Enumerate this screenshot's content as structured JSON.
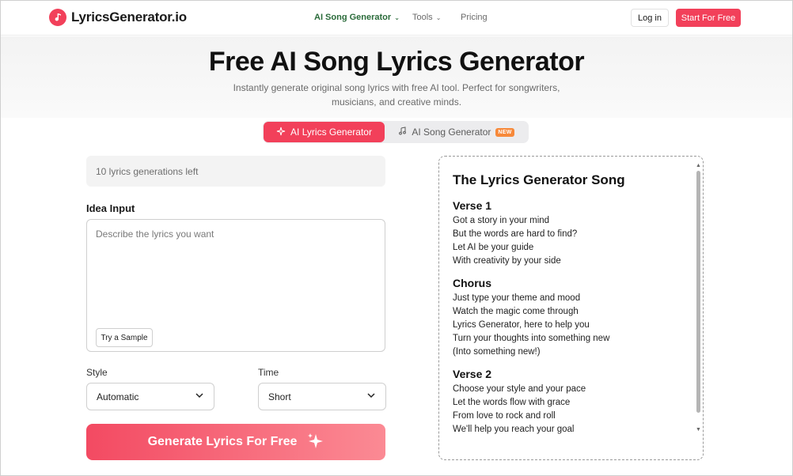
{
  "header": {
    "logo_text": "LyricsGenerator.io",
    "nav": [
      {
        "label": "AI Song Generator",
        "active": true
      },
      {
        "label": "Tools",
        "active": false
      },
      {
        "label": "Pricing",
        "active": false
      }
    ],
    "login_label": "Log in",
    "start_label": "Start For Free"
  },
  "hero": {
    "title": "Free AI Song Lyrics Generator",
    "subtitle": "Instantly generate original song lyrics with free AI tool. Perfect for songwriters, musicians, and creative minds."
  },
  "tabs": [
    {
      "label": "AI Lyrics Generator",
      "active": true
    },
    {
      "label": "AI Song Generator",
      "active": false,
      "badge": "NEW"
    }
  ],
  "form": {
    "generations_left": "10 lyrics generations left",
    "idea_label": "Idea Input",
    "idea_placeholder": "Describe the lyrics you want",
    "sample_label": "Try a Sample",
    "style_label": "Style",
    "style_value": "Automatic",
    "time_label": "Time",
    "time_value": "Short",
    "generate_label": "Generate Lyrics For Free"
  },
  "lyrics": {
    "title": "The Lyrics Generator Song",
    "sections": [
      {
        "heading": "Verse 1",
        "lines": [
          "Got a story in your mind",
          "But the words are hard to find?",
          "Let AI be your guide",
          "With creativity by your side"
        ]
      },
      {
        "heading": "Chorus",
        "lines": [
          "Just type your theme and mood",
          "Watch the magic come through",
          "Lyrics Generator, here to help you",
          "Turn your thoughts into something new",
          "(Into something new!)"
        ]
      },
      {
        "heading": "Verse 2",
        "lines": [
          "Choose your style and your pace",
          "Let the words flow with grace",
          "From love to rock and roll",
          "We'll help you reach your goal"
        ]
      }
    ]
  },
  "colors": {
    "accent": "#f2405a",
    "nav_active": "#2a6b3a"
  }
}
